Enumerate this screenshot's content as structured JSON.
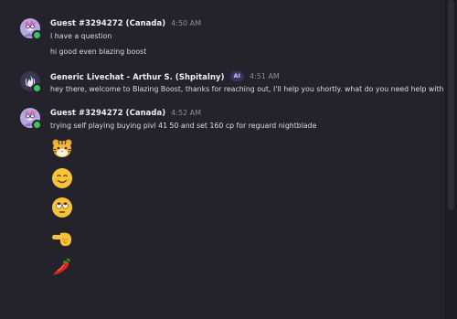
{
  "messages": [
    {
      "author": "Guest #3294272 (Canada)",
      "time": "4:50 AM",
      "lines": [
        "I have a question",
        "hi good even blazing boost"
      ]
    },
    {
      "author": "Generic Livechat - Arthur S. (Shpitalny)",
      "badge": "AI",
      "time": "4:51 AM",
      "lines": [
        "hey there, welcome to Blazing Boost, thanks for reaching out, I'll help you shortly. what do you need help with?"
      ]
    },
    {
      "author": "Guest #3294272 (Canada)",
      "time": "4:52 AM",
      "lines": [
        "trying self playing buying pivl 41 50 and set 160 cp for reguard nightblade"
      ]
    }
  ],
  "emojis": [
    "tiger-face-emoji",
    "smiling-face-emoji",
    "eye-roll-emoji",
    "pointing-hand-emoji",
    "hot-pepper-emoji"
  ],
  "colors": {
    "background": "#24232c",
    "online_status": "#3bc45a",
    "ai_badge_bg": "#3a335e",
    "ai_badge_text": "#c9c2ff"
  }
}
